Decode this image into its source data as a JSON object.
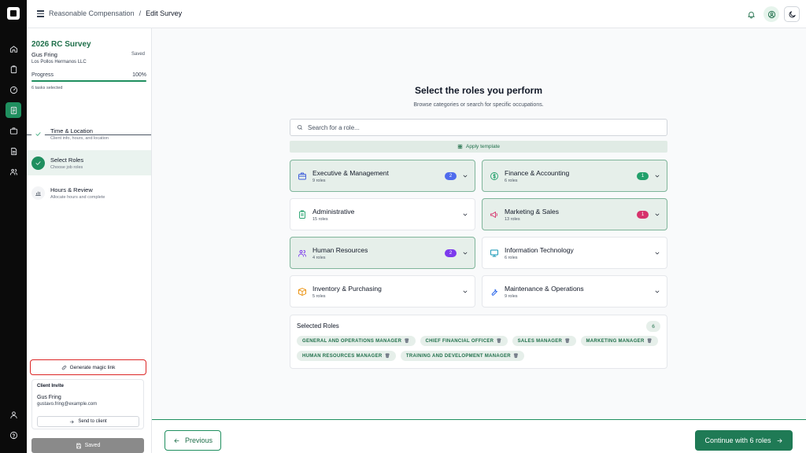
{
  "header": {
    "breadcrumb_parent": "Reasonable Compensation",
    "breadcrumb_separator": "/",
    "breadcrumb_current": "Edit Survey"
  },
  "survey": {
    "title": "2026 RC Survey",
    "user": "Gus Fring",
    "org": "Los Pollos Hermanos LLC",
    "status": "Saved",
    "progress_label": "Progress",
    "progress_value": "100%",
    "progress_fraction": 1.0,
    "tasks": "6 tasks selected"
  },
  "steps": [
    {
      "title": "Time & Location",
      "sub": "Client info, hours, and location",
      "state": "done"
    },
    {
      "title": "Select Roles",
      "sub": "Choose job roles",
      "state": "current"
    },
    {
      "title": "Hours & Review",
      "sub": "Allocate hours and complete",
      "state": "todo"
    }
  ],
  "sidebar_actions": {
    "magic_link": "Generate magic link",
    "invite_header": "Client Invite",
    "invite_name": "Gus Fring",
    "invite_email": "gustavo.fring@example.com",
    "send_label": "Send to client",
    "saved_label": "Saved"
  },
  "main": {
    "heading": "Select the roles you perform",
    "subheading": "Browse categories or search for specific occupations.",
    "search_placeholder": "Search for a role...",
    "apply_template": "Apply template"
  },
  "categories": [
    {
      "name": "Executive & Management",
      "count": "9 roles",
      "badge": "2",
      "selected": true,
      "icon": "briefcase-icon",
      "icon_color": "#3b5bdb",
      "badge_color": "#4f6bed"
    },
    {
      "name": "Finance & Accounting",
      "count": "6 roles",
      "badge": "1",
      "selected": true,
      "icon": "dollar-icon",
      "icon_color": "#22a06b",
      "badge_color": "#22a06b"
    },
    {
      "name": "Administrative",
      "count": "15 roles",
      "badge": "",
      "selected": false,
      "icon": "clipboard-icon",
      "icon_color": "#22a06b",
      "badge_color": ""
    },
    {
      "name": "Marketing & Sales",
      "count": "13 roles",
      "badge": "1",
      "selected": true,
      "icon": "megaphone-icon",
      "icon_color": "#d6336c",
      "badge_color": "#d6336c"
    },
    {
      "name": "Human Resources",
      "count": "4 roles",
      "badge": "2",
      "selected": true,
      "icon": "users-icon",
      "icon_color": "#7c3aed",
      "badge_color": "#7c3aed"
    },
    {
      "name": "Information Technology",
      "count": "6 roles",
      "badge": "",
      "selected": false,
      "icon": "monitor-icon",
      "icon_color": "#0891b2",
      "badge_color": ""
    },
    {
      "name": "Inventory & Purchasing",
      "count": "5 roles",
      "badge": "",
      "selected": false,
      "icon": "box-icon",
      "icon_color": "#ea8c00",
      "badge_color": ""
    },
    {
      "name": "Maintenance & Operations",
      "count": "9 roles",
      "badge": "",
      "selected": false,
      "icon": "wrench-icon",
      "icon_color": "#2563eb",
      "badge_color": ""
    }
  ],
  "selected_roles": {
    "title": "Selected Roles",
    "count": "6",
    "roles": [
      "GENERAL AND OPERATIONS MANAGER",
      "CHIEF FINANCIAL OFFICER",
      "SALES MANAGER",
      "MARKETING MANAGER",
      "HUMAN RESOURCES MANAGER",
      "TRAINING AND DEVELOPMENT MANAGER"
    ]
  },
  "footer": {
    "previous": "Previous",
    "continue": "Continue with 6 roles"
  }
}
